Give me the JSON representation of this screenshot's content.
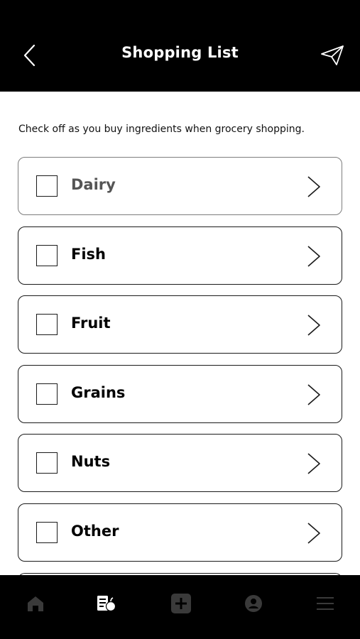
{
  "header": {
    "title": "Shopping List",
    "back_icon": "chevron-left-icon",
    "send_icon": "paper-plane-icon"
  },
  "description": "Check off as you buy ingredients when grocery shopping.",
  "categories": [
    {
      "label": "Dairy",
      "checked": false
    },
    {
      "label": "Fish",
      "checked": false
    },
    {
      "label": "Fruit",
      "checked": false
    },
    {
      "label": "Grains",
      "checked": false
    },
    {
      "label": "Nuts",
      "checked": false
    },
    {
      "label": "Other",
      "checked": false
    }
  ],
  "bottom_nav": {
    "items": [
      "home-icon",
      "shopping-list-icon",
      "add-icon",
      "profile-icon",
      "menu-icon"
    ],
    "active": "shopping-list-icon"
  },
  "colors": {
    "header_bg": "#000000",
    "nav_bg": "#000000",
    "active_nav": "#ffffff",
    "inactive_nav": "#3a3a3a"
  }
}
